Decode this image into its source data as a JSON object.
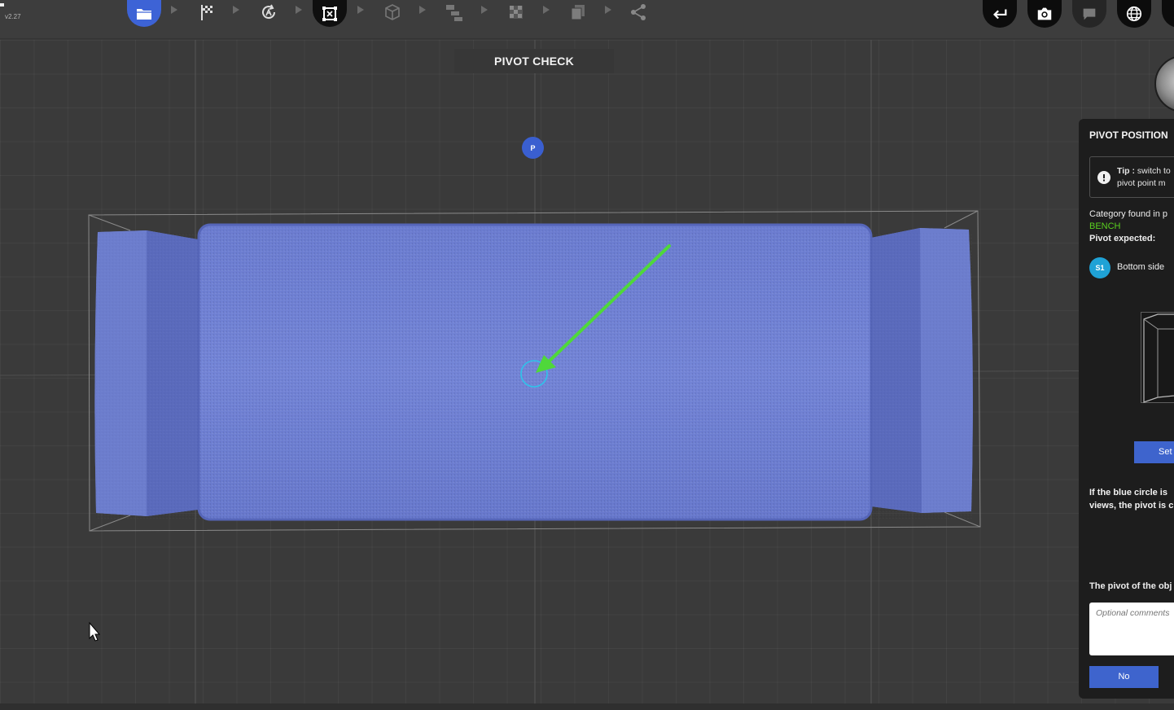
{
  "app": {
    "version": "v2.27"
  },
  "toolbar": {
    "steps": [
      {
        "icon": "folder-icon",
        "state": "active"
      },
      {
        "icon": "checkered-flag-icon",
        "state": "done"
      },
      {
        "icon": "rotation-icon",
        "state": "done"
      },
      {
        "icon": "pivot-frame-icon",
        "state": "current"
      },
      {
        "icon": "cube-icon",
        "state": "pending"
      },
      {
        "icon": "hierarchy-icon",
        "state": "pending"
      },
      {
        "icon": "checker-texture-icon",
        "state": "pending"
      },
      {
        "icon": "layers-icon",
        "state": "pending"
      },
      {
        "icon": "share-icon",
        "state": "pending"
      }
    ],
    "right_buttons": [
      {
        "icon": "undo-arrow-icon"
      },
      {
        "icon": "camera-icon"
      },
      {
        "icon": "chat-icon"
      },
      {
        "icon": "globe-icon"
      }
    ]
  },
  "viewport": {
    "title": "PIVOT CHECK",
    "pivot_marker_label": "P"
  },
  "panel": {
    "title": "PIVOT POSITION",
    "tip_label": "Tip :",
    "tip_line1": "switch to",
    "tip_line2": "pivot point m",
    "category_label": "Category found in p",
    "category_value": "BENCH",
    "pivot_expected_label": "Pivot expected:",
    "pivot_option_badge": "S1",
    "pivot_option_label": "Bottom side",
    "set_button": "Set",
    "note_line1": "If the blue circle  is",
    "note_line2": "views, the pivot is c",
    "question": "The pivot of the obj",
    "comments_placeholder": "Optional comments",
    "no_button": "No"
  },
  "colors": {
    "accent_blue": "#3e64cd",
    "category_green": "#5ad11f",
    "pivot_badge_cyan": "#1fa2d6",
    "arrow_green": "#4fd83a",
    "bench_fabric": "#6f80cf"
  }
}
